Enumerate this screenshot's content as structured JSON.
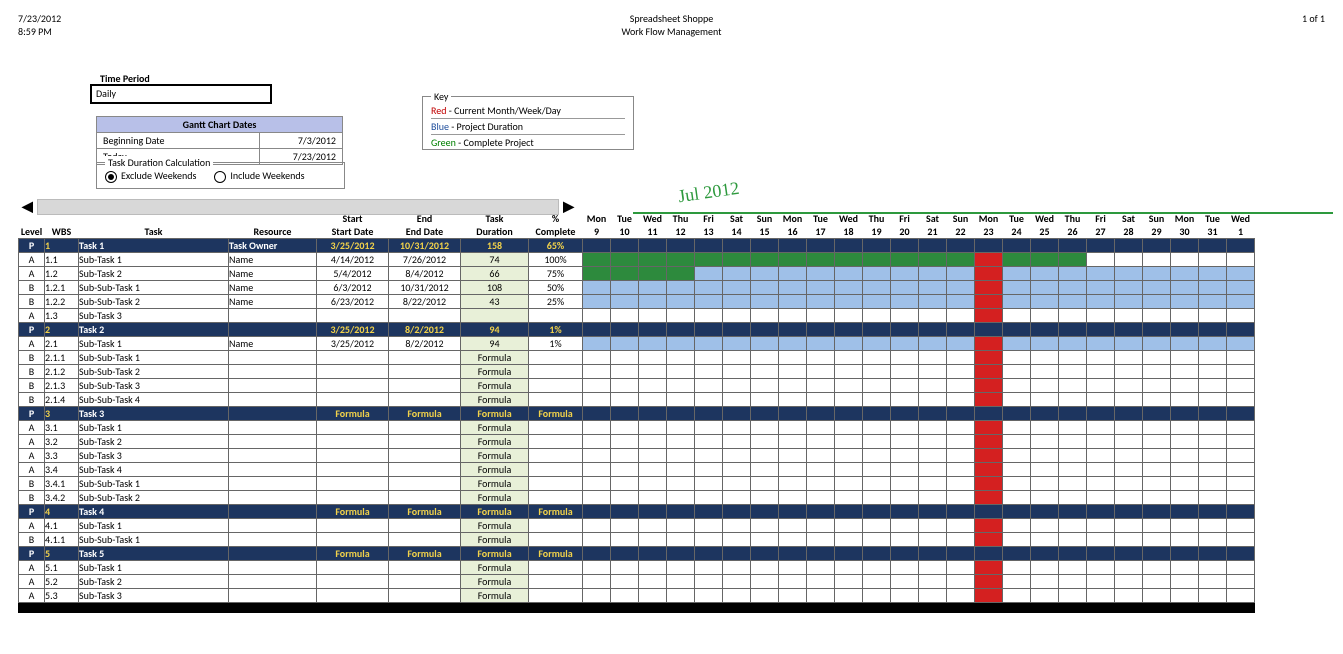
{
  "header": {
    "date": "7/23/2012",
    "time": "8:59 PM",
    "title1": "Spreadsheet Shoppe",
    "title2": "Work Flow Management",
    "page": "1 of 1"
  },
  "time_period": {
    "label": "Time Period",
    "value": "Daily"
  },
  "dates": {
    "title": "Gantt Chart Dates",
    "rows": [
      [
        "Beginning Date",
        "7/3/2012"
      ],
      [
        "Today",
        "7/23/2012"
      ]
    ]
  },
  "calc": {
    "title": "Task Duration Calculation",
    "opt1": "Exclude Weekends",
    "opt2": "Include Weekends",
    "selected": 0
  },
  "key": {
    "title": "Key",
    "rows": [
      {
        "color": "Red",
        "rest": " - Current Month/Week/Day"
      },
      {
        "color": "Blue",
        "rest": " - Project Duration"
      },
      {
        "color": "Green",
        "rest": " - Complete Project"
      }
    ]
  },
  "month": "Jul 2012",
  "columns": {
    "top": [
      "",
      "",
      "",
      "",
      "Start",
      "End",
      "Task",
      "%"
    ],
    "bottom": [
      "Level",
      "WBS",
      "Task",
      "Resource",
      "Start Date",
      "End Date",
      "Duration",
      "Complete"
    ]
  },
  "days": [
    {
      "dow": "Mon",
      "d": "9"
    },
    {
      "dow": "Tue",
      "d": "10"
    },
    {
      "dow": "Wed",
      "d": "11"
    },
    {
      "dow": "Thu",
      "d": "12"
    },
    {
      "dow": "Fri",
      "d": "13"
    },
    {
      "dow": "Sat",
      "d": "14"
    },
    {
      "dow": "Sun",
      "d": "15"
    },
    {
      "dow": "Mon",
      "d": "16"
    },
    {
      "dow": "Tue",
      "d": "17"
    },
    {
      "dow": "Wed",
      "d": "18"
    },
    {
      "dow": "Thu",
      "d": "19"
    },
    {
      "dow": "Fri",
      "d": "20"
    },
    {
      "dow": "Sat",
      "d": "21"
    },
    {
      "dow": "Sun",
      "d": "22"
    },
    {
      "dow": "Mon",
      "d": "23"
    },
    {
      "dow": "Tue",
      "d": "24"
    },
    {
      "dow": "Wed",
      "d": "25"
    },
    {
      "dow": "Thu",
      "d": "26"
    },
    {
      "dow": "Fri",
      "d": "27"
    },
    {
      "dow": "Sat",
      "d": "28"
    },
    {
      "dow": "Sun",
      "d": "29"
    },
    {
      "dow": "Mon",
      "d": "30"
    },
    {
      "dow": "Tue",
      "d": "31"
    },
    {
      "dow": "Wed",
      "d": "1"
    }
  ],
  "chart_data": {
    "type": "gantt",
    "date_range_start": "7/9/2012",
    "date_range_end": "8/1/2012",
    "today_index": 14,
    "rows": [
      {
        "level": "P",
        "wbs": "1",
        "task": "Task 1",
        "indent": 0,
        "res": "Task Owner",
        "start": "3/25/2012",
        "end": "10/31/2012",
        "dur": "158",
        "comp": "65%",
        "parent": true,
        "bar": {
          "s": 0,
          "e": 24,
          "c": "green"
        }
      },
      {
        "level": "A",
        "wbs": "1.1",
        "task": "Sub-Task 1",
        "indent": 1,
        "res": "Name",
        "start": "4/14/2012",
        "end": "7/26/2012",
        "dur": "74",
        "comp": "100%",
        "bar": {
          "s": 0,
          "e": 18,
          "c": "green"
        }
      },
      {
        "level": "A",
        "wbs": "1.2",
        "task": "Sub-Task 2",
        "indent": 1,
        "res": "Name",
        "start": "5/4/2012",
        "end": "8/4/2012",
        "dur": "66",
        "comp": "75%",
        "bar": {
          "s": 0,
          "e": 4,
          "c": "green",
          "s2": 4,
          "e2": 24,
          "c2": "blue"
        }
      },
      {
        "level": "B",
        "wbs": "1.2.1",
        "task": "Sub-Sub-Task 1",
        "indent": 2,
        "res": "Name",
        "start": "6/3/2012",
        "end": "10/31/2012",
        "dur": "108",
        "comp": "50%",
        "bar": {
          "s": 0,
          "e": 24,
          "c": "blue"
        }
      },
      {
        "level": "B",
        "wbs": "1.2.2",
        "task": "Sub-Sub-Task 2",
        "indent": 2,
        "res": "Name",
        "start": "6/23/2012",
        "end": "8/22/2012",
        "dur": "43",
        "comp": "25%",
        "bar": {
          "s": 0,
          "e": 24,
          "c": "blue"
        }
      },
      {
        "level": "A",
        "wbs": "1.3",
        "task": "Sub-Task 3",
        "indent": 1,
        "res": "",
        "start": "",
        "end": "",
        "dur": "",
        "comp": ""
      },
      {
        "level": "P",
        "wbs": "2",
        "task": "Task 2",
        "indent": 0,
        "res": "",
        "start": "3/25/2012",
        "end": "8/2/2012",
        "dur": "94",
        "comp": "1%",
        "parent": true,
        "bar": {
          "s": 0,
          "e": 24,
          "c": "blue"
        }
      },
      {
        "level": "A",
        "wbs": "2.1",
        "task": "Sub-Task 1",
        "indent": 1,
        "res": "Name",
        "start": "3/25/2012",
        "end": "8/2/2012",
        "dur": "94",
        "comp": "1%",
        "bar": {
          "s": 0,
          "e": 24,
          "c": "blue"
        }
      },
      {
        "level": "B",
        "wbs": "2.1.1",
        "task": "Sub-Sub-Task 1",
        "indent": 2,
        "res": "",
        "start": "",
        "end": "",
        "dur": "Formula",
        "comp": ""
      },
      {
        "level": "B",
        "wbs": "2.1.2",
        "task": "Sub-Sub-Task 2",
        "indent": 2,
        "res": "",
        "start": "",
        "end": "",
        "dur": "Formula",
        "comp": ""
      },
      {
        "level": "B",
        "wbs": "2.1.3",
        "task": "Sub-Sub-Task 3",
        "indent": 2,
        "res": "",
        "start": "",
        "end": "",
        "dur": "Formula",
        "comp": ""
      },
      {
        "level": "B",
        "wbs": "2.1.4",
        "task": "Sub-Sub-Task 4",
        "indent": 2,
        "res": "",
        "start": "",
        "end": "",
        "dur": "Formula",
        "comp": ""
      },
      {
        "level": "P",
        "wbs": "3",
        "task": "Task 3",
        "indent": 0,
        "res": "",
        "start": "Formula",
        "end": "Formula",
        "dur": "Formula",
        "comp": "Formula",
        "parent": true
      },
      {
        "level": "A",
        "wbs": "3.1",
        "task": "Sub-Task 1",
        "indent": 1,
        "res": "",
        "start": "",
        "end": "",
        "dur": "Formula",
        "comp": ""
      },
      {
        "level": "A",
        "wbs": "3.2",
        "task": "Sub-Task 2",
        "indent": 1,
        "res": "",
        "start": "",
        "end": "",
        "dur": "Formula",
        "comp": ""
      },
      {
        "level": "A",
        "wbs": "3.3",
        "task": "Sub-Task 3",
        "indent": 1,
        "res": "",
        "start": "",
        "end": "",
        "dur": "Formula",
        "comp": ""
      },
      {
        "level": "A",
        "wbs": "3.4",
        "task": "Sub-Task 4",
        "indent": 1,
        "res": "",
        "start": "",
        "end": "",
        "dur": "Formula",
        "comp": ""
      },
      {
        "level": "B",
        "wbs": "3.4.1",
        "task": "Sub-Sub-Task 1",
        "indent": 2,
        "res": "",
        "start": "",
        "end": "",
        "dur": "Formula",
        "comp": ""
      },
      {
        "level": "B",
        "wbs": "3.4.2",
        "task": "Sub-Sub-Task 2",
        "indent": 2,
        "res": "",
        "start": "",
        "end": "",
        "dur": "Formula",
        "comp": ""
      },
      {
        "level": "P",
        "wbs": "4",
        "task": "Task 4",
        "indent": 0,
        "res": "",
        "start": "Formula",
        "end": "Formula",
        "dur": "Formula",
        "comp": "Formula",
        "parent": true
      },
      {
        "level": "A",
        "wbs": "4.1",
        "task": "Sub-Task 1",
        "indent": 1,
        "res": "",
        "start": "",
        "end": "",
        "dur": "Formula",
        "comp": ""
      },
      {
        "level": "B",
        "wbs": "4.1.1",
        "task": "Sub-Sub-Task 1",
        "indent": 2,
        "res": "",
        "start": "",
        "end": "",
        "dur": "Formula",
        "comp": ""
      },
      {
        "level": "P",
        "wbs": "5",
        "task": "Task 5",
        "indent": 0,
        "res": "",
        "start": "Formula",
        "end": "Formula",
        "dur": "Formula",
        "comp": "Formula",
        "parent": true
      },
      {
        "level": "A",
        "wbs": "5.1",
        "task": "Sub-Task 1",
        "indent": 1,
        "res": "",
        "start": "",
        "end": "",
        "dur": "Formula",
        "comp": ""
      },
      {
        "level": "A",
        "wbs": "5.2",
        "task": "Sub-Task 2",
        "indent": 1,
        "res": "",
        "start": "",
        "end": "",
        "dur": "Formula",
        "comp": ""
      },
      {
        "level": "A",
        "wbs": "5.3",
        "task": "Sub-Task 3",
        "indent": 1,
        "res": "",
        "start": "",
        "end": "",
        "dur": "Formula",
        "comp": ""
      }
    ]
  }
}
